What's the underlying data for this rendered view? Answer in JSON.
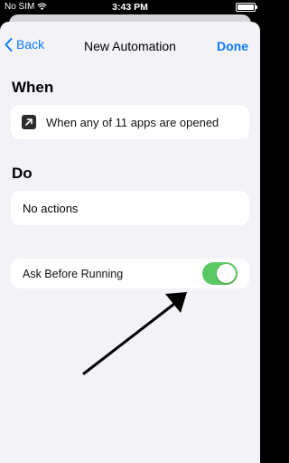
{
  "status_bar": {
    "carrier": "No SIM",
    "time": "3:43 PM"
  },
  "nav": {
    "back_label": "Back",
    "title": "New Automation",
    "done_label": "Done"
  },
  "when": {
    "heading": "When",
    "trigger_text": "When any of 11 apps are opened"
  },
  "do": {
    "heading": "Do",
    "actions_text": "No actions"
  },
  "ask_before_running": {
    "label": "Ask Before Running",
    "enabled": true
  },
  "colors": {
    "accent": "#0a7aff",
    "toggle_on": "#5ac864",
    "background": "#f2f2f7"
  }
}
